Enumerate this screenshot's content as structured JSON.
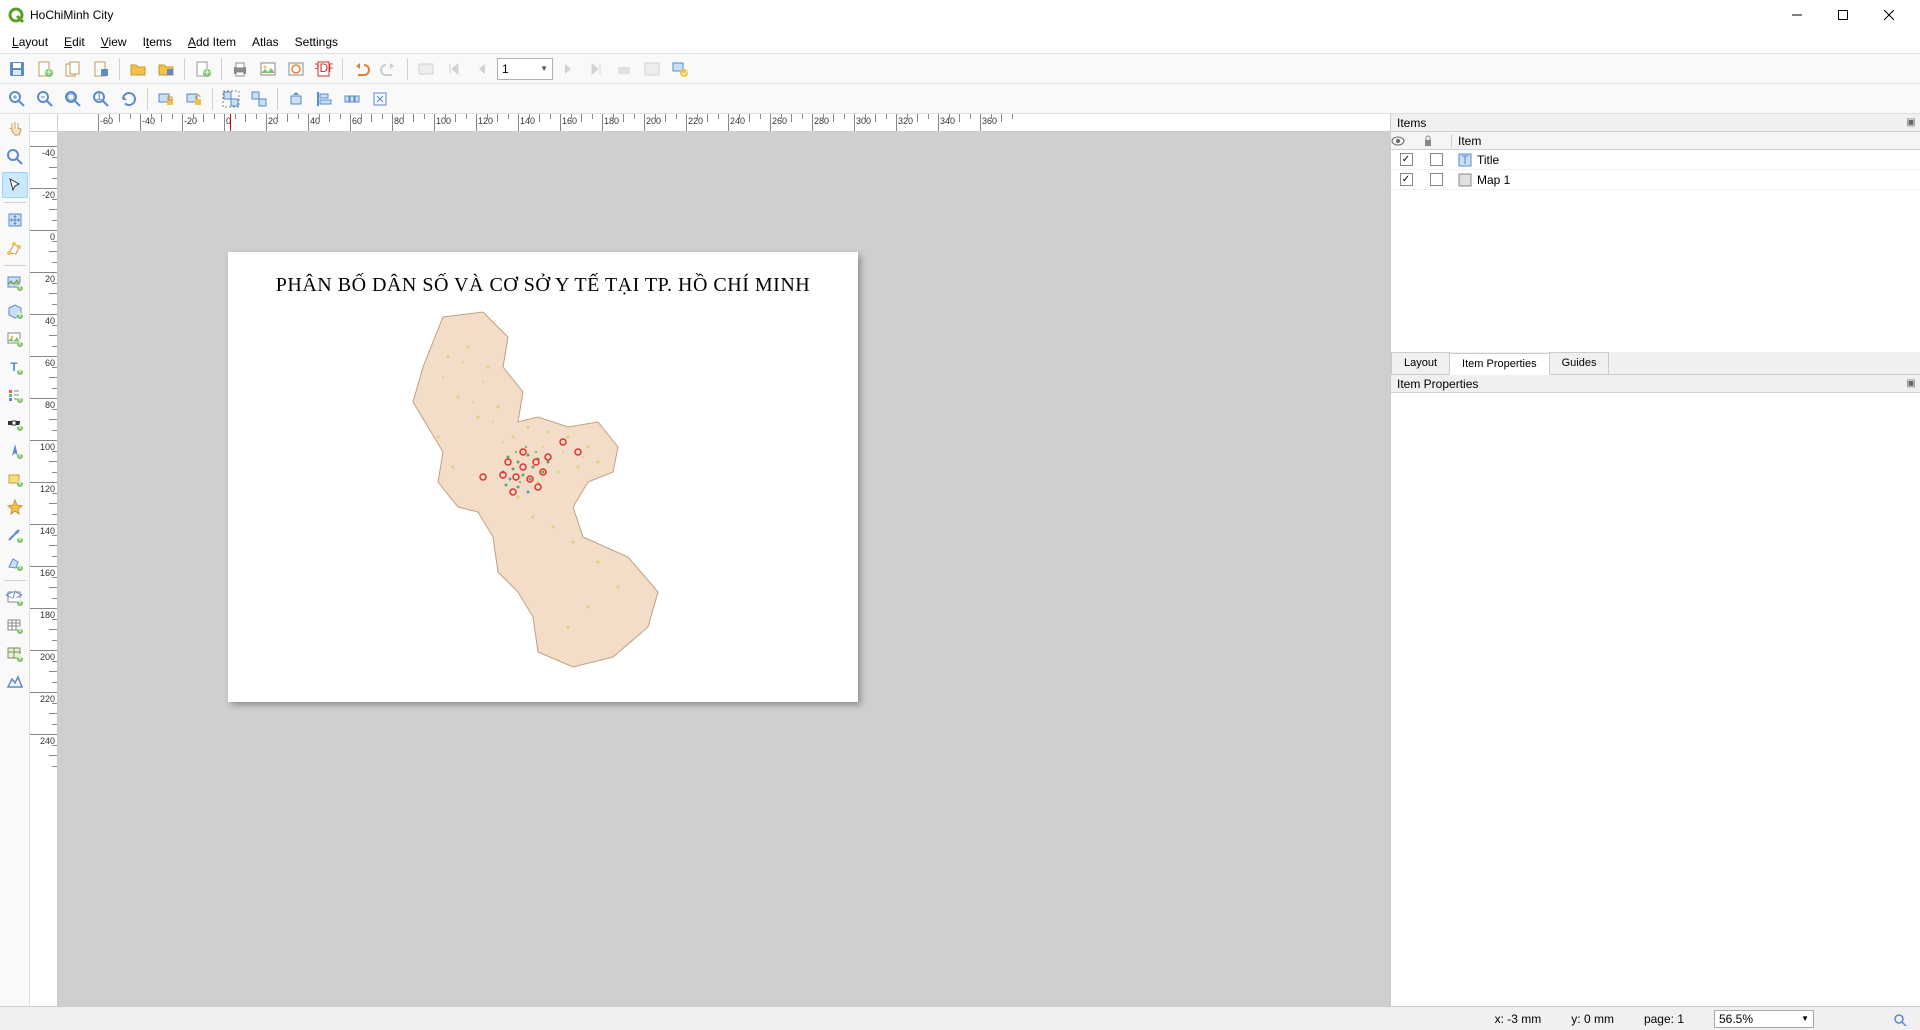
{
  "window": {
    "title": "HoChiMinh City"
  },
  "menu": {
    "layout": "Layout",
    "edit": "Edit",
    "view": "View",
    "items": "Items",
    "additem": "Add Item",
    "atlas": "Atlas",
    "settings": "Settings"
  },
  "toolbar": {
    "page_current": "1"
  },
  "ruler_h": [
    "-60",
    "-40",
    "-20",
    "0",
    "20",
    "40",
    "60",
    "80",
    "100",
    "120",
    "140",
    "160",
    "180",
    "200",
    "220",
    "240",
    "260",
    "280",
    "300",
    "320",
    "340",
    "360"
  ],
  "ruler_v": [
    "-40",
    "-20",
    "0",
    "20",
    "40",
    "60",
    "80",
    "100",
    "120",
    "140",
    "160",
    "180",
    "200",
    "220",
    "240"
  ],
  "panels": {
    "items": {
      "title": "Items",
      "col_item": "Item",
      "rows": [
        {
          "name": "Title"
        },
        {
          "name": "Map 1"
        }
      ]
    },
    "tabs": {
      "layout": "Layout",
      "itemprops": "Item Properties",
      "guides": "Guides"
    },
    "props": {
      "title": "Item Properties"
    }
  },
  "layout": {
    "title": "PHÂN BỐ DÂN SỐ VÀ CƠ SỞ Y TẾ TẠI TP. HỒ CHÍ MINH"
  },
  "status": {
    "x": "x: -3 mm",
    "y": "y: 0 mm",
    "page": "page: 1",
    "zoom": "56.5%"
  }
}
